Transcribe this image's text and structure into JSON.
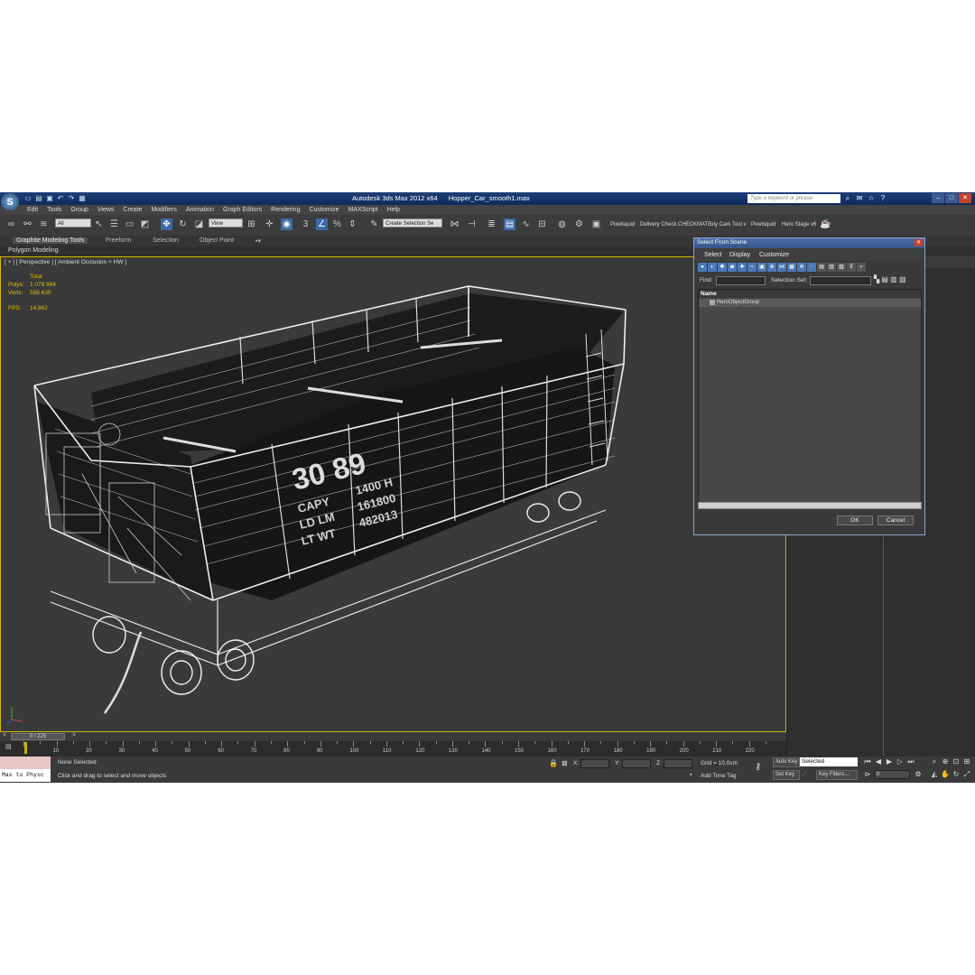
{
  "window": {
    "app_title": "Autodesk 3ds Max  2012 x64",
    "file_name": "Hopper_Car_smooth1.max",
    "search_placeholder": "Type a keyword or phrase"
  },
  "menu": [
    "Edit",
    "Tools",
    "Group",
    "Views",
    "Create",
    "Modifiers",
    "Animation",
    "Graph Editors",
    "Rendering",
    "Customize",
    "MAXScript",
    "Help"
  ],
  "toolbar": {
    "selection_filter": "All",
    "reference_coord": "View",
    "named_selection": "Create Selection Se",
    "plugin_labels": [
      "Pixelsquid",
      "Delivery Check",
      "CHECKMATE",
      "uty Cam Tool v",
      "Pixelsquid",
      "Hero Stage v6"
    ]
  },
  "ribbon": {
    "tabs": [
      "Graphite Modeling Tools",
      "Freeform",
      "Selection",
      "Object Paint"
    ],
    "sub_label": "Polygon Modeling"
  },
  "viewport": {
    "label": "[ + ] [ Perspective ] [ Ambient Occlusion + HW ]",
    "stats_header": "Total",
    "polys_label": "Polys:",
    "polys_value": "1 079 994",
    "verts_label": "Verts:",
    "verts_value": "556 630",
    "fps_label": "FPS:",
    "fps_value": "14,862",
    "car_number": "30 89",
    "car_text_left": [
      "CAPY",
      "LD LM",
      "LT WT"
    ],
    "car_text_right": [
      "1400 H",
      "161800",
      "482013"
    ]
  },
  "dialog": {
    "title": "Select From Scene",
    "menu": [
      "Select",
      "Display",
      "Customize"
    ],
    "find_label": "Find:",
    "selection_set_label": "Selection Set:",
    "column_name": "Name",
    "items": [
      "HeroObjectGroup"
    ],
    "ok_label": "OK",
    "cancel_label": "Cancel"
  },
  "timeline": {
    "frame_display": "0 / 225",
    "ticks": [
      "10",
      "20",
      "30",
      "40",
      "50",
      "60",
      "70",
      "80",
      "90",
      "100",
      "110",
      "120",
      "130",
      "140",
      "150",
      "160",
      "170",
      "180",
      "190",
      "200",
      "210",
      "220"
    ]
  },
  "status": {
    "maxscript_input": "Max to Physc",
    "selection_status": "None Selected",
    "prompt": "Click and drag to select and move objects",
    "x_label": "X:",
    "y_label": "Y:",
    "z_label": "Z:",
    "grid": "Grid = 10,0cm",
    "add_time_tag": "Add Time Tag",
    "auto_key": "Auto Key",
    "set_key": "Set Key",
    "key_mode": "Selected",
    "key_filters": "Key Filters...",
    "current_frame": "0"
  }
}
